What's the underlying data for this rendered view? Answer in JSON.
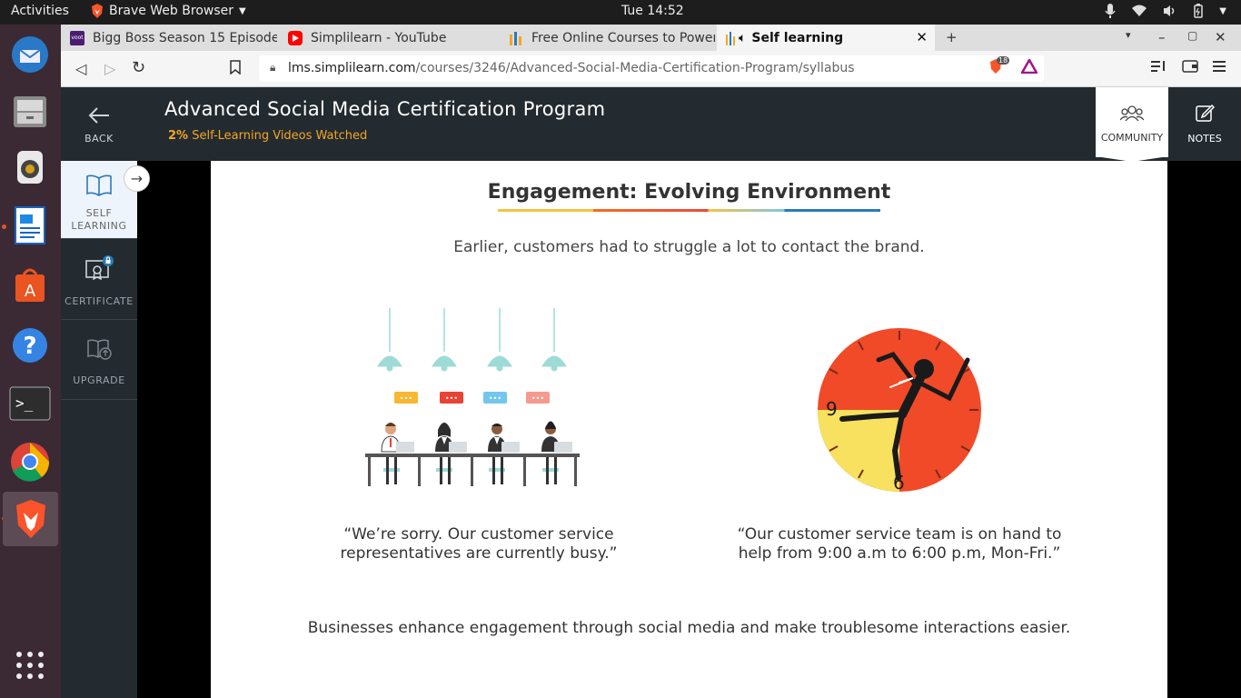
{
  "os": {
    "activities": "Activities",
    "app_menu": "Brave Web Browser",
    "clock": "Tue 14:52"
  },
  "tabs": [
    {
      "title": "Bigg Boss Season 15 Episode",
      "favicon": "voot"
    },
    {
      "title": "Simplilearn - YouTube",
      "favicon": "youtube"
    },
    {
      "title": "Free Online Courses to Power",
      "favicon": "simplilearn"
    },
    {
      "title": "Self learning",
      "favicon": "simplilearn",
      "active": true
    }
  ],
  "address": {
    "host": "lms.simplilearn.com",
    "path": "/courses/3246/Advanced-Social-Media-Certification-Program/syllabus",
    "shields_count": "18"
  },
  "header": {
    "back_label": "BACK",
    "course_title": "Advanced Social Media Certification Program",
    "progress_percent": "2%",
    "progress_label": "Self-Learning Videos Watched",
    "community_label": "COMMUNITY",
    "notes_label": "NOTES"
  },
  "sidebar": {
    "items": [
      {
        "label_line1": "SELF",
        "label_line2": "LEARNING"
      },
      {
        "label": "CERTIFICATE"
      },
      {
        "label": "UPGRADE"
      }
    ]
  },
  "slide": {
    "title": "Engagement: Evolving Environment",
    "subtitle": "Earlier, customers had to struggle a lot to contact the brand.",
    "left_quote_line1": "“We’re sorry. Our customer service",
    "left_quote_line2": "representatives are currently busy.”",
    "right_quote_line1": "“Our customer service team is on hand to",
    "right_quote_line2": "help from 9:00 a.m to 6:00 p.m, Mon-Fri.”",
    "clock_num_9": "9",
    "clock_num_6": "6",
    "footer": "Businesses enhance engagement through social media and make troublesome interactions easier."
  },
  "colors": {
    "header_bg": "#232b30",
    "accent_orange": "#f5a623",
    "clock_red": "#f04a28",
    "clock_yellow": "#f7e15e"
  }
}
